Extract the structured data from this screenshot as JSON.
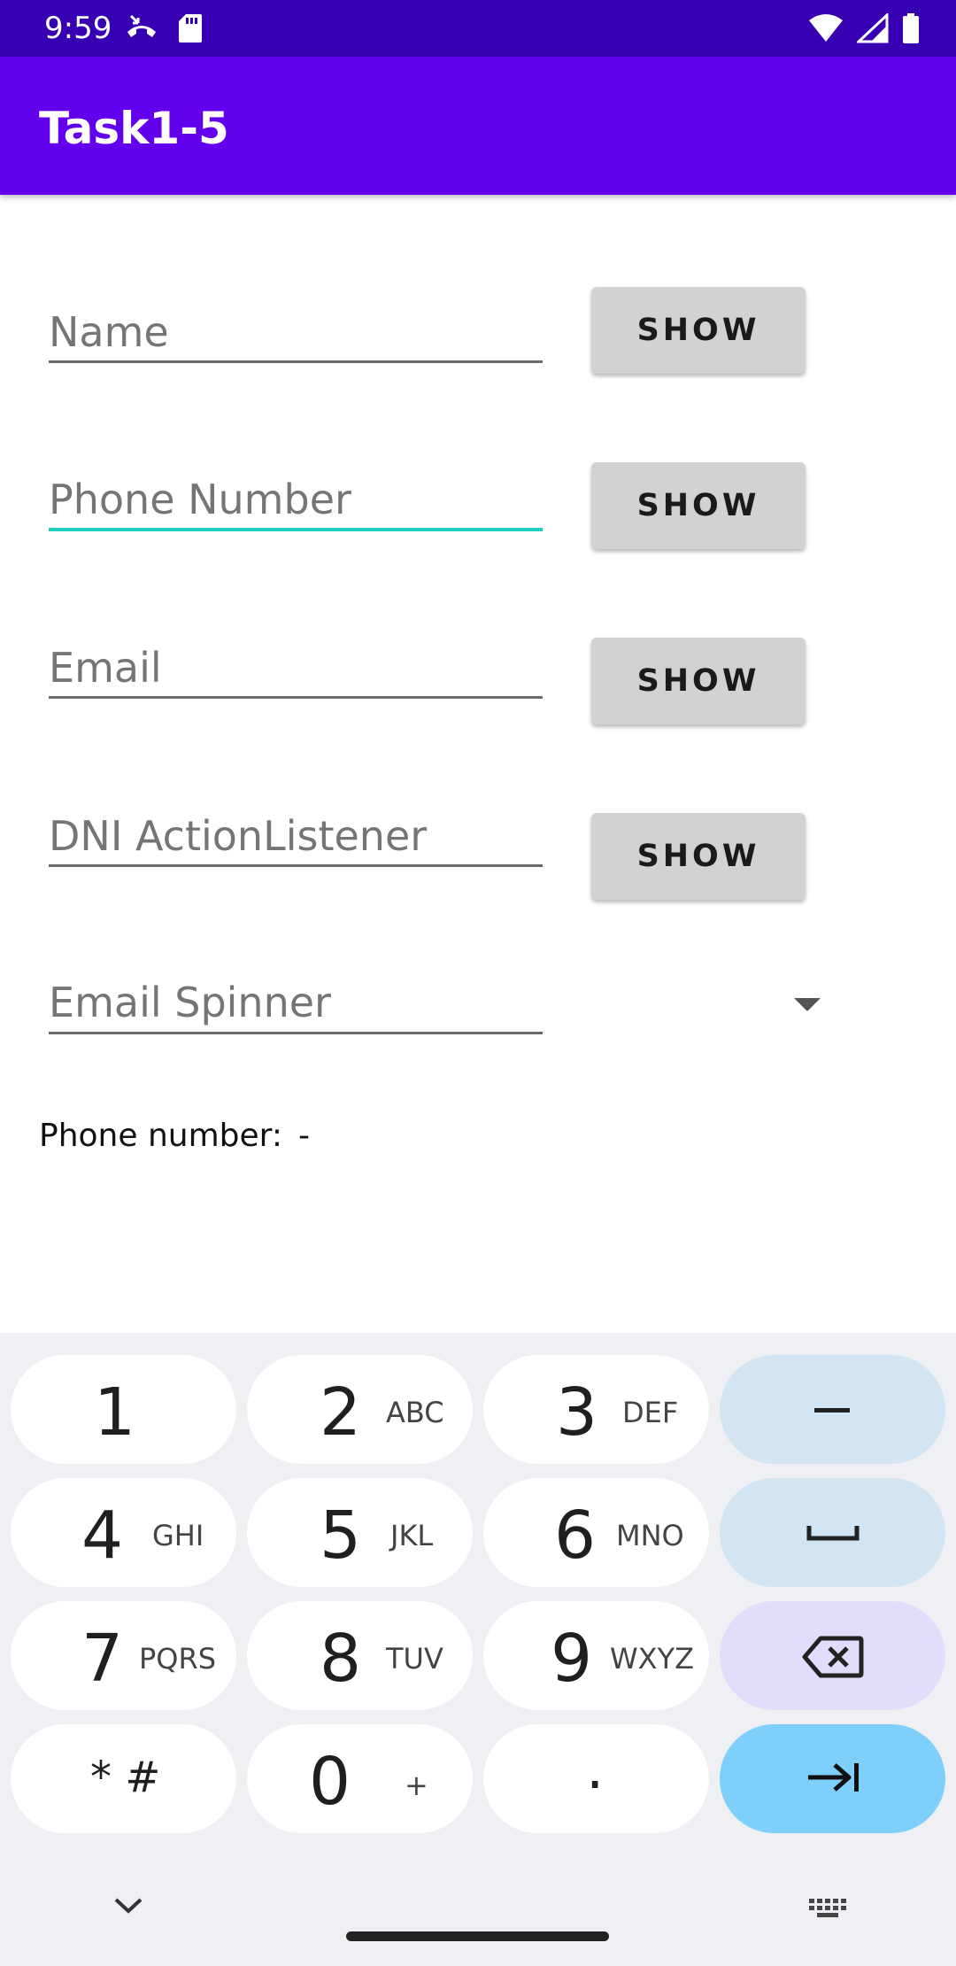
{
  "status_bar": {
    "time": "9:59",
    "left_icons": [
      "missed-call-icon",
      "sd-card-icon"
    ],
    "right_icons": [
      "wifi-icon",
      "signal-icon",
      "battery-icon"
    ]
  },
  "app_bar": {
    "title": "Task1-5"
  },
  "form": {
    "name": {
      "placeholder": "Name",
      "button": "SHOW"
    },
    "phone": {
      "placeholder": "Phone Number",
      "button": "SHOW",
      "focused": true
    },
    "email": {
      "placeholder": "Email",
      "button": "SHOW"
    },
    "dni": {
      "placeholder": "DNI ActionListener",
      "button": "SHOW"
    },
    "spinner": {
      "label": "Email Spinner",
      "icon": "dropdown-arrow-icon"
    }
  },
  "phone_info": {
    "label": "Phone number:",
    "value": "-"
  },
  "keyboard": {
    "rows": [
      [
        {
          "d": "1",
          "s": ""
        },
        {
          "d": "2",
          "s": "ABC"
        },
        {
          "d": "3",
          "s": "DEF"
        },
        {
          "action": "minus-icon"
        }
      ],
      [
        {
          "d": "4",
          "s": "GHI"
        },
        {
          "d": "5",
          "s": "JKL"
        },
        {
          "d": "6",
          "s": "MNO"
        },
        {
          "action": "space-icon"
        }
      ],
      [
        {
          "d": "7",
          "s": "PQRS"
        },
        {
          "d": "8",
          "s": "TUV"
        },
        {
          "d": "9",
          "s": "WXYZ"
        },
        {
          "action": "backspace-icon"
        }
      ],
      [
        {
          "d": "* #",
          "s": ""
        },
        {
          "d": "0",
          "s": "+"
        },
        {
          "d": ".",
          "s": ""
        },
        {
          "action": "next-field-icon"
        }
      ]
    ],
    "nav_icons": [
      "chevron-down-icon",
      "keyboard-icon"
    ]
  },
  "colors": {
    "status_bar": "#3700b3",
    "app_bar": "#6200ee",
    "focus_underline": "#1fcfc1",
    "button": "#d2d2d2",
    "keyboard_bg": "#eff0f3",
    "action_key": "#d3e4f2",
    "delete_key": "#e2ddfb",
    "enter_key": "#7ed0fb"
  }
}
